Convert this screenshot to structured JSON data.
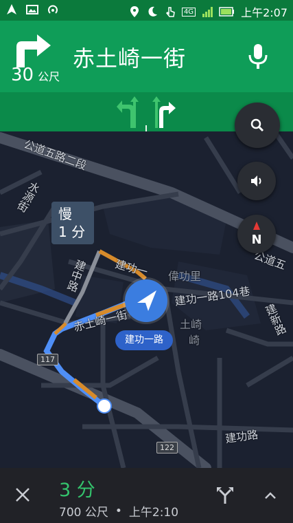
{
  "status": {
    "time": "上午2:07",
    "left_icons": [
      "navigation-icon",
      "image-icon",
      "hotspot-icon"
    ],
    "right_icons": [
      "location-icon",
      "moon-icon",
      "touch-icon",
      "lte-icon",
      "signal-icon",
      "battery-icon"
    ],
    "lte": "4G"
  },
  "nav": {
    "distance_value": "30",
    "distance_unit": "公尺",
    "street": "赤土崎一街",
    "turn_icon": "turn-right-icon",
    "mic_icon": "mic-icon",
    "lanes": [
      "turn-left-lane-icon",
      "turn-right-lane-icon"
    ],
    "colors": {
      "header": "#0f9d58",
      "lane_bar": "#0b8a4a",
      "status": "#0b7a3c"
    }
  },
  "map": {
    "slow_line1": "慢",
    "slow_line2": "1 分",
    "current_road": "建功一路",
    "labels": {
      "gongdao5_sec2": "公道五路二段",
      "shuiyuan": "水源街",
      "jianzhong": "建中路",
      "jiangong1_top": "建功一",
      "weigongli": "偉功里",
      "jiangong1_104": "建功一路104巷",
      "chituqi1": "赤土崎一街",
      "tuqi": "土崎",
      "gongdao5_right": "公道五",
      "jianxin": "建新路",
      "jiangong": "建功路",
      "qi": "崎"
    },
    "shields": {
      "route117": "117",
      "route122": "122"
    },
    "compass_letter": "N",
    "colors": {
      "route": "#4f8ff7",
      "traffic": "#d78b2b",
      "bg": "#1b2130"
    }
  },
  "buttons": {
    "search_icon": "search-icon",
    "sound_icon": "volume-icon",
    "compass_icon": "compass-icon"
  },
  "bottom": {
    "eta": "3 分",
    "distance": "700 公尺",
    "separator": "•",
    "arrival": "上午2:10",
    "close_icon": "close-icon",
    "alt_routes_icon": "alt-routes-icon",
    "expand_icon": "chevron-up-icon"
  }
}
